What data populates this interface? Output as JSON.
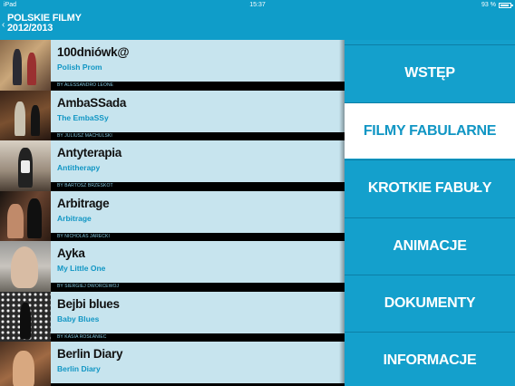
{
  "status": {
    "device": "iPad",
    "time": "15:37",
    "battery": "93 %",
    "battery_level": 0.93
  },
  "header": {
    "title_line1": "POLSKIE FILMY",
    "title_line2": "2012/2013"
  },
  "films": [
    {
      "title": "100dniówk@",
      "subtitle": "Polish Prom",
      "director": "BY ALESSANDRO LEONE"
    },
    {
      "title": "AmbaSSada",
      "subtitle": "The EmbaSSy",
      "director": "BY JULIUSZ MACHULSKI"
    },
    {
      "title": "Antyterapia",
      "subtitle": "Antitherapy",
      "director": "BY BARTOSZ BRZESKOT"
    },
    {
      "title": "Arbitrage",
      "subtitle": "Arbitrage",
      "director": "BY NICHOLAS JARECKI"
    },
    {
      "title": "Ayka",
      "subtitle": "My Little One",
      "director": "BY SIERGIEJ DWORCEWOJ"
    },
    {
      "title": "Bejbi blues",
      "subtitle": "Baby Blues",
      "director": "BY KASIA ROSŁANIEC"
    },
    {
      "title": "Berlin Diary",
      "subtitle": "Berlin Diary",
      "director": ""
    }
  ],
  "menu": {
    "items": [
      "WSTĘP",
      "FILMY FABULARNE",
      "KROTKIE FABUŁY",
      "ANIMACJE",
      "DOKUMENTY",
      "INFORMACJE"
    ],
    "active_index": 1
  },
  "colors": {
    "accent": "#0f9dc9",
    "row_bg": "#c7e4ee",
    "subtitle": "#1196c4"
  }
}
